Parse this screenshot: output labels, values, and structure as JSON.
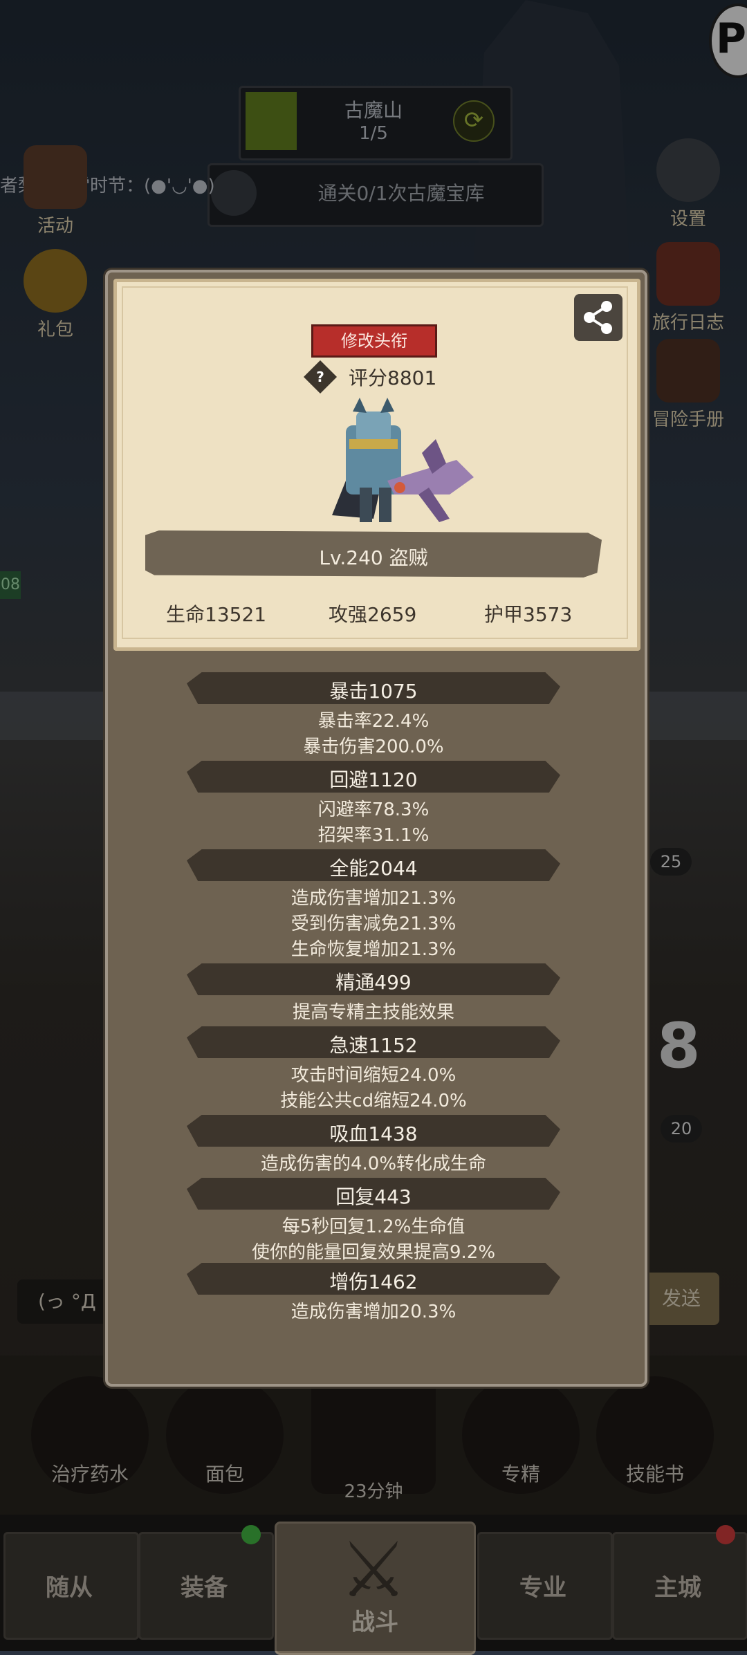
{
  "hud": {
    "stage_name": "古魔山",
    "stage_progress": "1/5",
    "quest": "通关0/1次古魔宝库",
    "marquee": "者梨花若雪时节：(●'◡'●)"
  },
  "left_menu": [
    {
      "label": "活动"
    },
    {
      "label": "礼包"
    }
  ],
  "right_menu": [
    {
      "label": "设置"
    },
    {
      "label": "旅行日志"
    },
    {
      "label": "冒险手册"
    }
  ],
  "profile": {
    "title_button": "修改头衔",
    "score_icon": "?",
    "score": "评分8801",
    "level_class": "Lv.240 盗贼",
    "base_stats": [
      "生命13521",
      "攻强2659",
      "护甲3573"
    ]
  },
  "stats": [
    {
      "name": "暴击1075",
      "lines": [
        "暴击率22.4%",
        "暴击伤害200.0%"
      ]
    },
    {
      "name": "回避1120",
      "lines": [
        "闪避率78.3%",
        "招架率31.1%"
      ]
    },
    {
      "name": "全能2044",
      "lines": [
        "造成伤害增加21.3%",
        "受到伤害减免21.3%",
        "生命恢复增加21.3%"
      ]
    },
    {
      "name": "精通499",
      "lines": [
        "提高专精主技能效果"
      ]
    },
    {
      "name": "急速1152",
      "lines": [
        "攻击时间缩短24.0%",
        "技能公共cd缩短24.0%"
      ]
    },
    {
      "name": "吸血1438",
      "lines": [
        "造成伤害的4.0%转化成生命"
      ]
    },
    {
      "name": "回复443",
      "lines": [
        "每5秒回复1.2%生命值",
        "使你的能量回复效果提高9.2%"
      ]
    },
    {
      "name": "增伤1462",
      "lines": [
        "造成伤害增加20.3%"
      ]
    }
  ],
  "background_text": {
    "chat_left": "(っ °Д °",
    "chat_send": "发送",
    "badge_1": "25",
    "badge_2": "20",
    "big_digit": "8",
    "level_chip": "08"
  },
  "shop": [
    {
      "label": "治疗药水"
    },
    {
      "label": "面包"
    },
    {
      "label": "专精"
    },
    {
      "label": "技能书"
    }
  ],
  "shop_timer": "23分钟",
  "nav": {
    "tabs": [
      "随从",
      "装备",
      "战斗",
      "专业",
      "主城"
    ]
  },
  "colors": {
    "panel": "#6e6251",
    "card": "#eee1c3",
    "stat_bar": "#3d352c",
    "title_button": "#b72e2a"
  }
}
